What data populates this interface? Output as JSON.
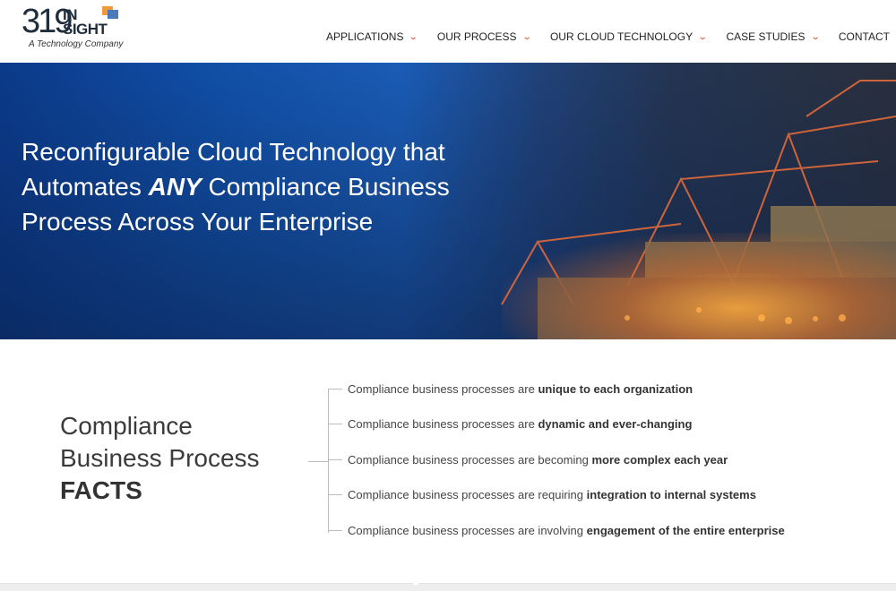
{
  "logo": {
    "number": "319",
    "word1": "IN",
    "word2": "SIGHT",
    "tagline": "A Technology Company"
  },
  "nav": {
    "items": [
      {
        "label": "APPLICATIONS",
        "has_dropdown": true
      },
      {
        "label": "OUR PROCESS",
        "has_dropdown": true
      },
      {
        "label": "OUR CLOUD TECHNOLOGY",
        "has_dropdown": true
      },
      {
        "label": "CASE STUDIES",
        "has_dropdown": true
      },
      {
        "label": "CONTACT",
        "has_dropdown": false
      }
    ],
    "dropdown_icon": "chevron-down-icon",
    "accent_color": "#e8452c"
  },
  "hero": {
    "line1": "Reconfigurable Cloud Technology that",
    "line2_pre": "Automates ",
    "line2_em": "ANY",
    "line2_post": " Compliance Business",
    "line3": "Process Across Your Enterprise"
  },
  "facts": {
    "heading_line1": "Compliance",
    "heading_line2": "Business Process",
    "heading_line3": "FACTS",
    "items": [
      {
        "prefix": "Compliance business processes are ",
        "emphasis": "unique to each organization"
      },
      {
        "prefix": "Compliance business processes are ",
        "emphasis": "dynamic and ever-changing"
      },
      {
        "prefix": "Compliance business processes are becoming ",
        "emphasis": "more complex each year"
      },
      {
        "prefix": "Compliance business processes are requiring ",
        "emphasis": "integration to internal systems"
      },
      {
        "prefix": "Compliance business processes are involving ",
        "emphasis": "engagement of the entire enterprise"
      }
    ]
  }
}
